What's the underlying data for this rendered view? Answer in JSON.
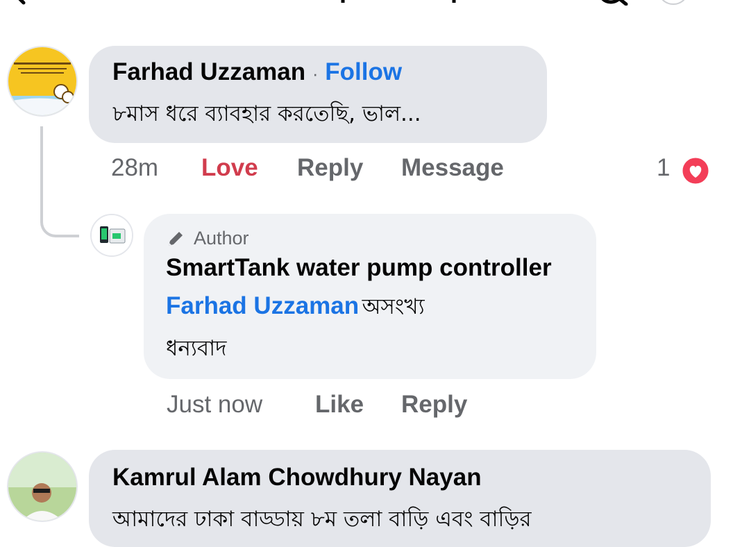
{
  "comments": [
    {
      "author": "Farhad Uzzaman",
      "separator": "·",
      "follow_label": "Follow",
      "text": "৮মাস ধরে ব্যাবহার করতেছি, ভাল...",
      "time": "28m",
      "reaction_label": "Love",
      "reply_label": "Reply",
      "message_label": "Message",
      "reaction_count": "1"
    },
    {
      "badge_label": "Author",
      "author": "SmartTank water pump controller",
      "mention": "Farhad Uzzaman",
      "text_line1": "অসংখ্য",
      "text_line2": "ধন্যবাদ",
      "time": "Just now",
      "like_label": "Like",
      "reply_label": "Reply"
    },
    {
      "author": "Kamrul Alam Chowdhury Nayan",
      "text": "আমাদের ঢাকা বাড্ডায়  ৮ম তলা বাড়ি এবং বাড়ির"
    }
  ],
  "colors": {
    "link": "#1b74e4",
    "love": "#d13c4d",
    "bubble": "#e4e6eb",
    "bubble_reply": "#f0f2f5",
    "meta": "#65676b"
  },
  "icons": [
    "back-arrow-icon",
    "search-icon",
    "more-icon",
    "heart-reaction-icon",
    "pencil-icon"
  ]
}
